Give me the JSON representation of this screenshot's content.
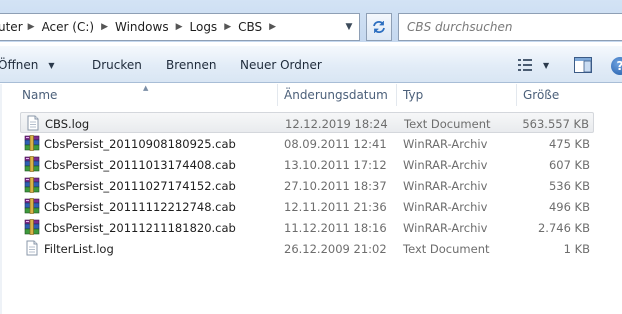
{
  "address": {
    "breadcrumbs": [
      "uter",
      "Acer (C:)",
      "Windows",
      "Logs",
      "CBS"
    ]
  },
  "search": {
    "placeholder": "CBS durchsuchen"
  },
  "toolbar": {
    "open_label": "Öffnen",
    "print_label": "Drucken",
    "burn_label": "Brennen",
    "new_folder_label": "Neuer Ordner"
  },
  "columns": {
    "name": "Name",
    "date": "Änderungsdatum",
    "type": "Typ",
    "size": "Größe"
  },
  "files": [
    {
      "name": "CBS.log",
      "date": "12.12.2019 18:24",
      "type": "Text Document",
      "size": "563.557 KB",
      "icon": "text-file-icon",
      "selected": true
    },
    {
      "name": "CbsPersist_20110908180925.cab",
      "date": "08.09.2011 12:41",
      "type": "WinRAR-Archiv",
      "size": "475 KB",
      "icon": "winrar-archive-icon",
      "selected": false
    },
    {
      "name": "CbsPersist_20111013174408.cab",
      "date": "13.10.2011 17:12",
      "type": "WinRAR-Archiv",
      "size": "607 KB",
      "icon": "winrar-archive-icon",
      "selected": false
    },
    {
      "name": "CbsPersist_20111027174152.cab",
      "date": "27.10.2011 18:37",
      "type": "WinRAR-Archiv",
      "size": "536 KB",
      "icon": "winrar-archive-icon",
      "selected": false
    },
    {
      "name": "CbsPersist_20111112212748.cab",
      "date": "12.11.2011 21:36",
      "type": "WinRAR-Archiv",
      "size": "496 KB",
      "icon": "winrar-archive-icon",
      "selected": false
    },
    {
      "name": "CbsPersist_20111211181820.cab",
      "date": "11.12.2011 18:16",
      "type": "WinRAR-Archiv",
      "size": "2.746 KB",
      "icon": "winrar-archive-icon",
      "selected": false
    },
    {
      "name": "FilterList.log",
      "date": "26.12.2009 21:02",
      "type": "Text Document",
      "size": "1 KB",
      "icon": "text-file-icon",
      "selected": false
    }
  ],
  "colors": {
    "address_bg": "#c5d8ef",
    "toolbar_bg": "#e2ecf7",
    "header_text": "#4c607a",
    "detail_text": "#6d6d6d"
  }
}
